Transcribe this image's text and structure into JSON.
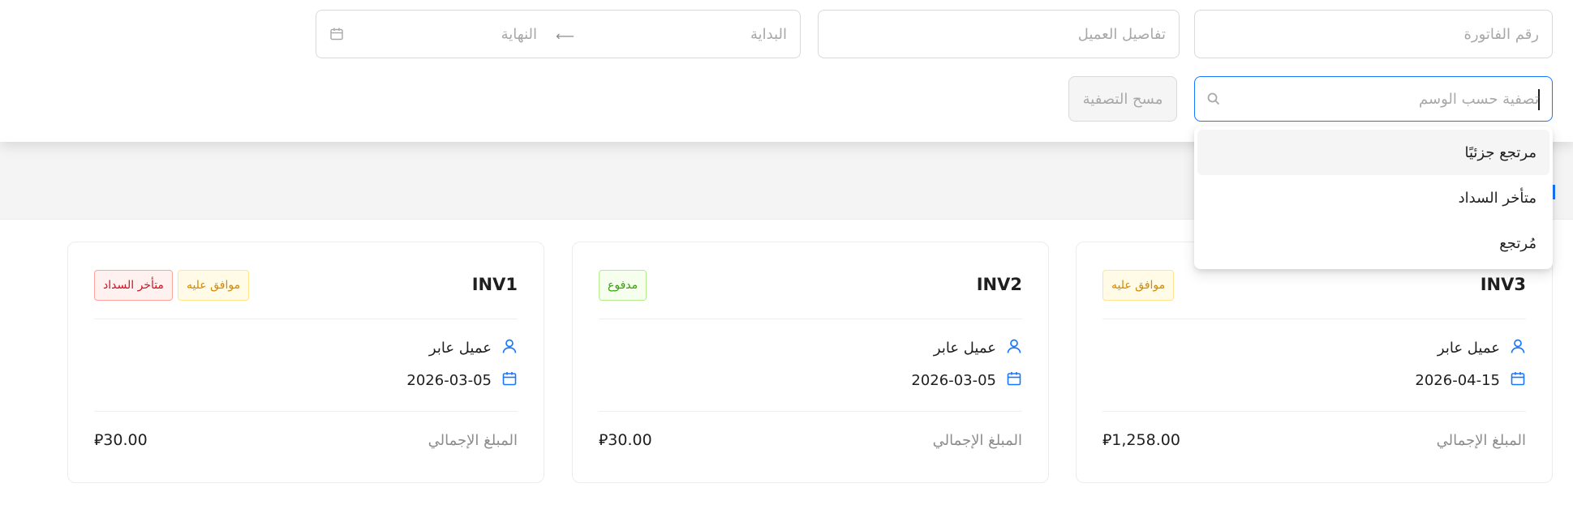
{
  "filters": {
    "invoice_number_placeholder": "رقم الفاتورة",
    "customer_details_placeholder": "تفاصيل العميل",
    "date_start_placeholder": "البداية",
    "date_end_placeholder": "النهاية",
    "tag_filter_placeholder": "تصفية حسب الوسم",
    "clear_filters_label": "مسح التصفية"
  },
  "tag_dropdown": {
    "options": [
      "مرتجع جزئيًا",
      "متأخر السداد",
      "مُرتجع"
    ],
    "highlighted_index": 0
  },
  "invoices": [
    {
      "code": "INV3",
      "tags": [
        {
          "label": "موافق عليه",
          "color": "gold"
        }
      ],
      "customer": "عميل عابر",
      "date": "2026-04-15",
      "total_label": "المبلغ الإجمالي",
      "total": "1,258.00",
      "currency_symbol": "⃁"
    },
    {
      "code": "INV2",
      "tags": [
        {
          "label": "مدفوع",
          "color": "green"
        }
      ],
      "customer": "عميل عابر",
      "date": "2026-03-05",
      "total_label": "المبلغ الإجمالي",
      "total": "30.00",
      "currency_symbol": "⃁"
    },
    {
      "code": "INV1",
      "tags": [
        {
          "label": "موافق عليه",
          "color": "gold"
        },
        {
          "label": "متأخر السداد",
          "color": "red"
        }
      ],
      "customer": "عميل عابر",
      "date": "2026-03-05",
      "total_label": "المبلغ الإجمالي",
      "total": "30.00",
      "currency_symbol": "⃁"
    }
  ],
  "colors": {
    "accent": "#1677ff",
    "tag_gold": "#d48806",
    "tag_green": "#389e0d",
    "tag_red": "#cf1322"
  }
}
